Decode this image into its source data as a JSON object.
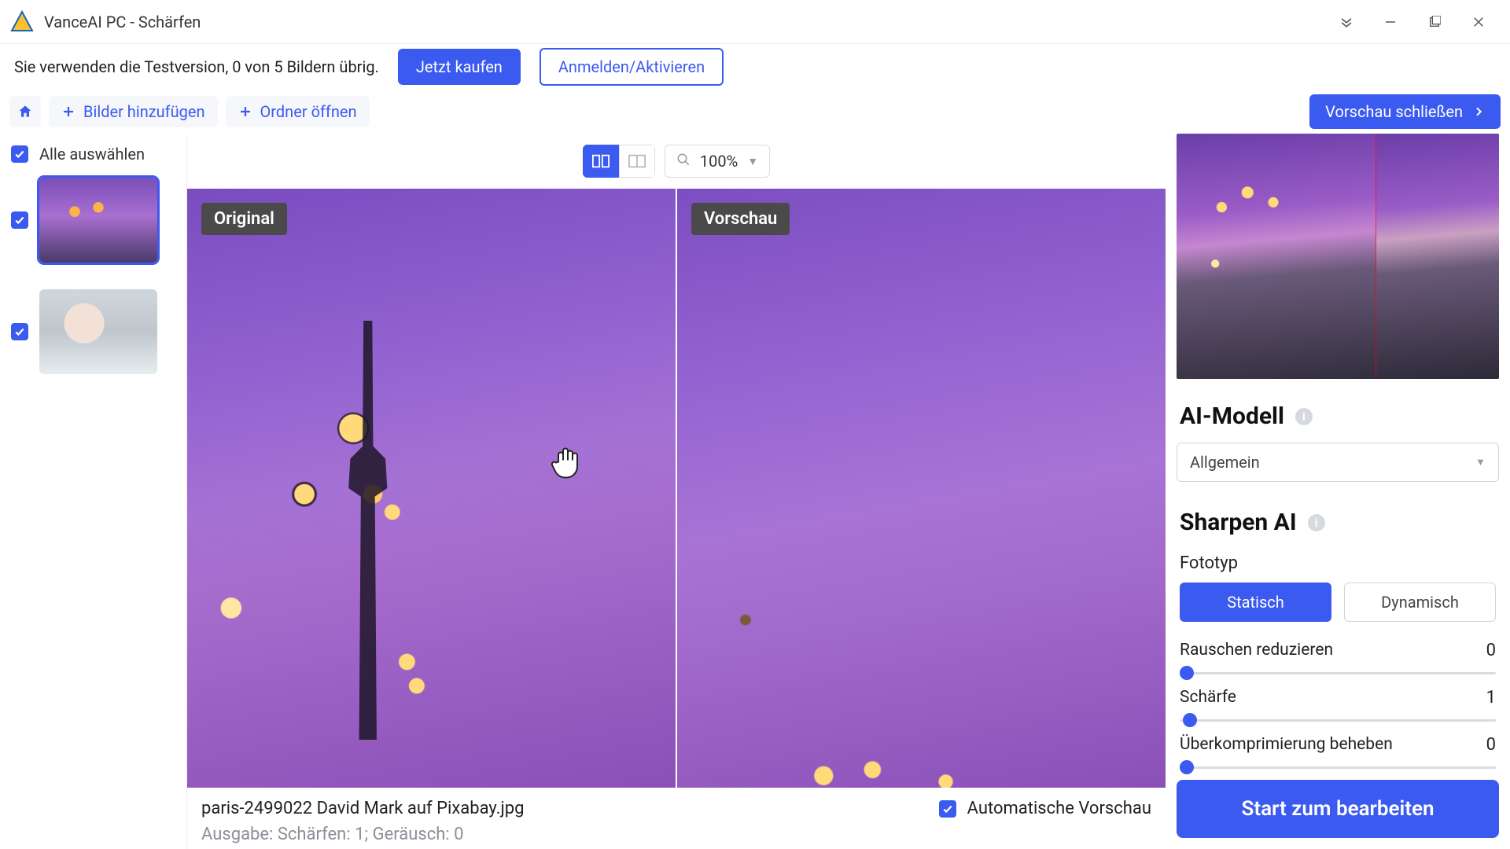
{
  "titlebar": {
    "app_title": "VanceAI PC - Schärfen"
  },
  "trial": {
    "message": "Sie verwenden die Testversion, 0 von 5 Bildern übrig.",
    "buy": "Jetzt kaufen",
    "login": "Anmelden/Aktivieren"
  },
  "actionbar": {
    "add_images": "Bilder hinzufügen",
    "open_folder": "Ordner öffnen",
    "close_preview": "Vorschau schließen"
  },
  "thumbs": {
    "select_all": "Alle auswählen"
  },
  "view": {
    "zoom": "100%"
  },
  "compare": {
    "original_tag": "Original",
    "preview_tag": "Vorschau"
  },
  "fileinfo": {
    "filename": "paris-2499022  David Mark auf Pixabay.jpg",
    "output": "Ausgabe: Schärfen: 1; Geräusch: 0",
    "auto_preview": "Automatische Vorschau"
  },
  "settings": {
    "ai_model_title": "AI-Modell",
    "ai_model_value": "Allgemein",
    "sharpen_title": "Sharpen AI",
    "photo_type_label": "Fototyp",
    "photo_type_static": "Statisch",
    "photo_type_dynamic": "Dynamisch",
    "slider_noise": "Rauschen reduzieren",
    "slider_noise_val": "0",
    "slider_sharp": "Schärfe",
    "slider_sharp_val": "1",
    "slider_overcomp": "Überkomprimierung beheben",
    "slider_overcomp_val": "0",
    "start": "Start zum bearbeiten"
  }
}
